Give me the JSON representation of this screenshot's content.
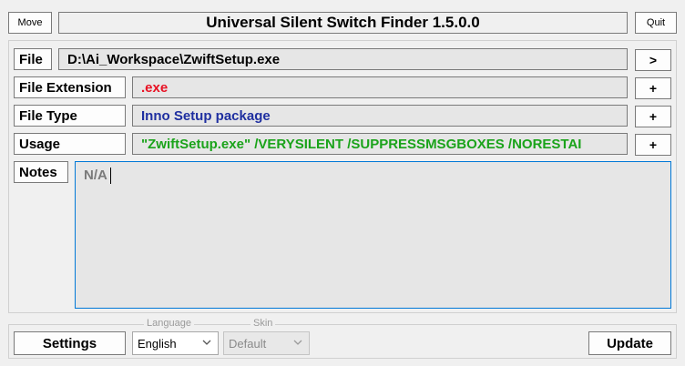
{
  "header": {
    "move_label": "Move",
    "title": "Universal Silent Switch Finder 1.5.0.0",
    "quit_label": "Quit"
  },
  "rows": {
    "file": {
      "label": "File",
      "value": "D:\\Ai_Workspace\\ZwiftSetup.exe",
      "button": ">"
    },
    "extension": {
      "label": "File Extension",
      "value": ".exe",
      "button": "+",
      "value_color": "#e81123"
    },
    "type": {
      "label": "File Type",
      "value": "Inno Setup package",
      "button": "+",
      "value_color": "#1f2fa0"
    },
    "usage": {
      "label": "Usage",
      "value": "\"ZwiftSetup.exe\" /VERYSILENT /SUPPRESSMSGBOXES /NORESTAI",
      "button": "+",
      "value_color": "#1aa31a"
    },
    "notes": {
      "label": "Notes",
      "value": "N/A"
    }
  },
  "footer": {
    "settings_label": "Settings",
    "language_legend": "Language",
    "language_value": "English",
    "skin_legend": "Skin",
    "skin_value": "Default",
    "update_label": "Update"
  },
  "colors": {
    "notes_border": "#0078d7",
    "notes_bg": "#e6e6e6"
  }
}
